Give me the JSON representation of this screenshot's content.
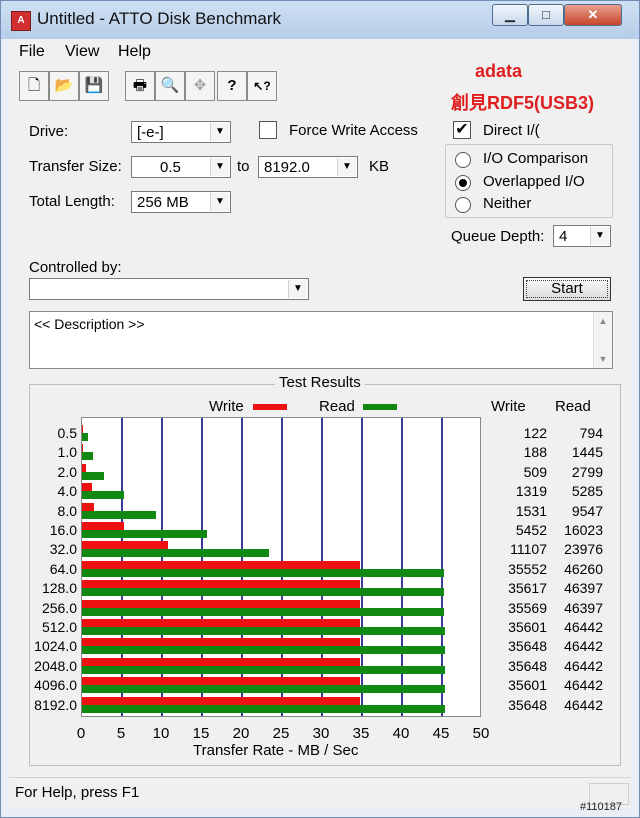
{
  "window": {
    "title": "Untitled - ATTO Disk Benchmark",
    "minimize_glyph": "▁",
    "maximize_glyph": "□",
    "close_glyph": "✕"
  },
  "menu": [
    "File",
    "View",
    "Help"
  ],
  "toolbar": {
    "buttons": [
      {
        "icon": "new-document-icon",
        "glyph": "🗋"
      },
      {
        "icon": "open-folder-icon",
        "glyph": "📂"
      },
      {
        "icon": "save-icon",
        "glyph": "💾"
      },
      {
        "icon": "print-icon",
        "glyph": "🖶"
      },
      {
        "icon": "print-preview-icon",
        "glyph": "🔍"
      },
      {
        "icon": "move-icon",
        "glyph": "✥"
      },
      {
        "icon": "help-icon",
        "glyph": "?"
      },
      {
        "icon": "context-help-icon",
        "glyph": "↖?"
      }
    ]
  },
  "watermark": {
    "line1": "adata",
    "line2": "創見RDF5(USB3)",
    "color": "#e02020"
  },
  "form": {
    "drive_label": "Drive:",
    "drive_value": "[-e-]",
    "force_write_label": "Force Write Access",
    "force_write_checked": false,
    "direct_io_label": "Direct I/(",
    "direct_io_checked": true,
    "transfer_size_label": "Transfer Size:",
    "transfer_from": "0.5",
    "to_label": "to",
    "transfer_to": "8192.0",
    "kb_label": "KB",
    "total_length_label": "Total Length:",
    "total_length_value": "256 MB",
    "io_options": [
      {
        "label": "I/O Comparison",
        "selected": false
      },
      {
        "label": "Overlapped I/O",
        "selected": true
      },
      {
        "label": "Neither",
        "selected": false
      }
    ],
    "queue_depth_label": "Queue Depth:",
    "queue_depth_value": "4",
    "controlled_by_label": "Controlled by:",
    "controlled_by_value": "",
    "start_label": "Start",
    "description_placeholder": "<< Description >>"
  },
  "results": {
    "title": "Test Results",
    "legend_write": "Write",
    "legend_read": "Read",
    "col_write": "Write",
    "col_read": "Read",
    "write_color": "#ee1111",
    "read_color": "#118811"
  },
  "chart_data": {
    "type": "bar",
    "orientation": "horizontal",
    "title": "Test Results",
    "xlabel": "Transfer Rate - MB / Sec",
    "ylabel": "",
    "xlim": [
      0,
      50
    ],
    "xticks": [
      0,
      5,
      10,
      15,
      20,
      25,
      30,
      35,
      40,
      45,
      50
    ],
    "grid": true,
    "legend_position": "top",
    "categories": [
      "0.5",
      "1.0",
      "2.0",
      "4.0",
      "8.0",
      "16.0",
      "32.0",
      "64.0",
      "128.0",
      "256.0",
      "512.0",
      "1024.0",
      "2048.0",
      "4096.0",
      "8192.0"
    ],
    "series": [
      {
        "name": "Write",
        "color": "#ee1111",
        "values": [
          0.12,
          0.18,
          0.5,
          1.29,
          1.5,
          5.3,
          10.8,
          34.7,
          34.8,
          34.7,
          34.8,
          34.8,
          34.8,
          34.8,
          34.8
        ]
      },
      {
        "name": "Read",
        "color": "#118811",
        "values": [
          0.78,
          1.4,
          2.7,
          5.2,
          9.3,
          15.6,
          23.4,
          45.2,
          45.3,
          45.3,
          45.4,
          45.4,
          45.4,
          45.4,
          45.4
        ]
      }
    ],
    "table_write": [
      "122",
      "188",
      "509",
      "1319",
      "1531",
      "5452",
      "11107",
      "35552",
      "35617",
      "35569",
      "35601",
      "35648",
      "35648",
      "35601",
      "35648"
    ],
    "table_read": [
      "794",
      "1445",
      "2799",
      "5285",
      "9547",
      "16023",
      "23976",
      "46260",
      "46397",
      "46397",
      "46442",
      "46442",
      "46442",
      "46442",
      "46442"
    ]
  },
  "status": {
    "text": "For Help, press F1",
    "post_id": "#110187"
  }
}
